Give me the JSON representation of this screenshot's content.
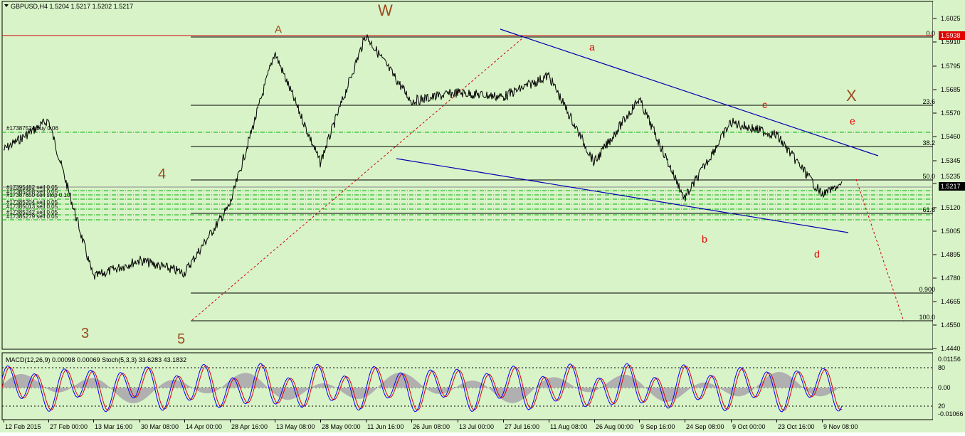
{
  "symbol_header": "GBPUSD,H4  1.5204  1.5217  1.5202  1.5217",
  "price_axis": {
    "ticks": [
      "1.6025",
      "1.5910",
      "1.5795",
      "1.5685",
      "1.5570",
      "1.5460",
      "1.5345",
      "1.5235",
      "1.5120",
      "1.5005",
      "1.4895",
      "1.4780",
      "1.4665",
      "1.4550",
      "1.4440"
    ],
    "badge_resistance": "1.5938",
    "badge_current": "1.5217",
    "badge_resistance_color": "#e00000",
    "badge_current_color": "#000000"
  },
  "fib_labels": [
    "0.0",
    "23.6",
    "38.2",
    "50.0",
    "61.8",
    "0.900",
    "100.0"
  ],
  "wave_labels": {
    "W": "W",
    "A": "A",
    "X": "X",
    "three": "3",
    "four": "4",
    "five": "5",
    "a": "a",
    "b": "b",
    "c": "c",
    "d": "d",
    "e": "e"
  },
  "orders": {
    "buy": "#17387524 buy 0.06",
    "sells": [
      "#17395482 sell 0.05",
      "#17385268 sell 0.05",
      "#17387650 sell stop 0.10",
      "#17385204 sell 0.05",
      "#17385013 sell 0.05",
      "#17385242 sell 0.05",
      "#17385279 sell 0.05"
    ]
  },
  "indicator_header": "MACD(12,26,9)  0.00098  0.00069   Stoch(5,3,3)  33.6283  43.1832",
  "indicator_axis": {
    "top": "0.01156",
    "level80": "80",
    "zero": "0.00",
    "level20": "20",
    "bottom": "-0.01066"
  },
  "time_axis": [
    "12 Feb 2015",
    "27 Feb 00:00",
    "13 Mar 16:00",
    "30 Mar 08:00",
    "14 Apr 00:00",
    "28 Apr 16:00",
    "13 May 08:00",
    "28 May 00:00",
    "11 Jun 16:00",
    "26 Jun 08:00",
    "13 Jul 00:00",
    "27 Jul 16:00",
    "11 Aug 08:00",
    "26 Aug 00:00",
    "9 Sep 16:00",
    "24 Sep 08:00",
    "9 Oct 00:00",
    "23 Oct 16:00",
    "9 Nov 08:00"
  ],
  "colors": {
    "background": "#d8f3c8",
    "price_line": "#000000",
    "trend_line": "#0000b0",
    "red_line": "#d00000",
    "order_line": "#00b000",
    "wave_brown": "#9b4a1e",
    "wave_red": "#e00000",
    "macd_hist": "#b0b0b0",
    "stoch_main": "#0000ff",
    "stoch_signal": "#e00000"
  },
  "chart_data": {
    "type": "line",
    "title": "GBPUSD,H4",
    "ylim": [
      1.444,
      1.608
    ],
    "x": [
      "12 Feb 2015",
      "27 Feb 00:00",
      "13 Mar 16:00",
      "30 Mar 08:00",
      "14 Apr 00:00",
      "28 Apr 16:00",
      "13 May 08:00",
      "28 May 00:00",
      "11 Jun 16:00",
      "26 Jun 08:00",
      "13 Jul 00:00",
      "27 Jul 16:00",
      "11 Aug 08:00",
      "26 Aug 00:00",
      "9 Sep 16:00",
      "24 Sep 08:00",
      "9 Oct 00:00",
      "23 Oct 16:00",
      "9 Nov 08:00"
    ],
    "series": [
      {
        "name": "GBPUSD",
        "values": [
          1.538,
          1.552,
          1.478,
          1.486,
          1.48,
          1.512,
          1.584,
          1.532,
          1.592,
          1.561,
          1.565,
          1.563,
          1.573,
          1.532,
          1.562,
          1.515,
          1.551,
          1.545,
          1.517
        ]
      }
    ],
    "last": 1.5217
  }
}
